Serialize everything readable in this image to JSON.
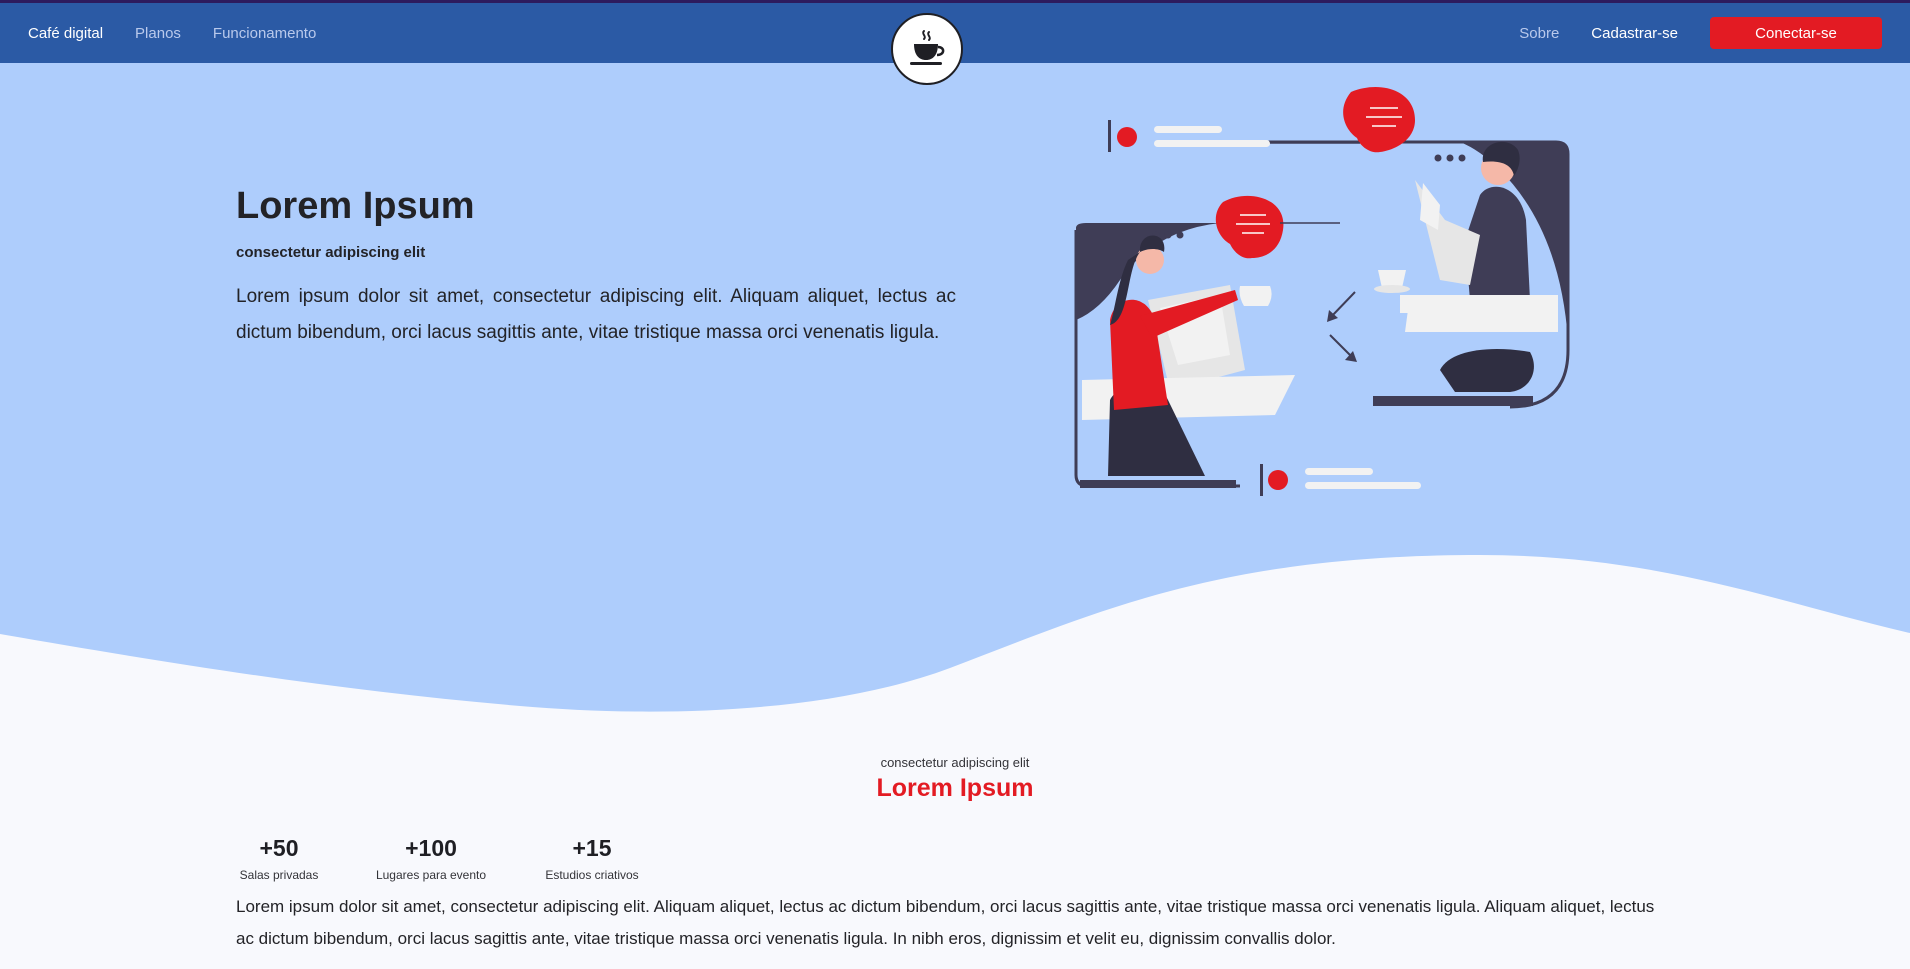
{
  "nav": {
    "brand": "Café digital",
    "links": [
      "Planos",
      "Funcionamento"
    ],
    "about": "Sobre",
    "signup": "Cadastrar-se",
    "connect": "Conectar-se"
  },
  "hero": {
    "title": "Lorem Ipsum",
    "subtitle": "consectetur adipiscing elit",
    "paragraph": "Lorem ipsum dolor sit amet, consectetur adipiscing elit. Aliquam aliquet, lectus ac dictum bibendum, orci lacus sagittis ante, vitae tristique massa orci venenatis ligula."
  },
  "section": {
    "subtitle": "consectetur adipiscing elit",
    "title": "Lorem Ipsum",
    "stats": [
      {
        "value": "+50",
        "label": "Salas privadas"
      },
      {
        "value": "+100",
        "label": "Lugares para evento"
      },
      {
        "value": "+15",
        "label": "Estudios criativos"
      }
    ],
    "paragraph": "Lorem ipsum dolor sit amet, consectetur adipiscing elit. Aliquam aliquet, lectus ac dictum bibendum, orci lacus sagittis ante, vitae tristique massa orci venenatis ligula. Aliquam aliquet, lectus ac dictum bibendum, orci lacus sagittis ante, vitae tristique massa orci venenatis ligula. In nibh eros, dignissim et velit eu, dignissim convallis dolor."
  },
  "icons": {
    "logo": "coffee-cup-icon",
    "illustration": "video-call-illustration"
  },
  "colors": {
    "navbar": "#2b5aa5",
    "hero": "#aecdfc",
    "accent": "#e31b23",
    "background": "#f8f9fd"
  }
}
